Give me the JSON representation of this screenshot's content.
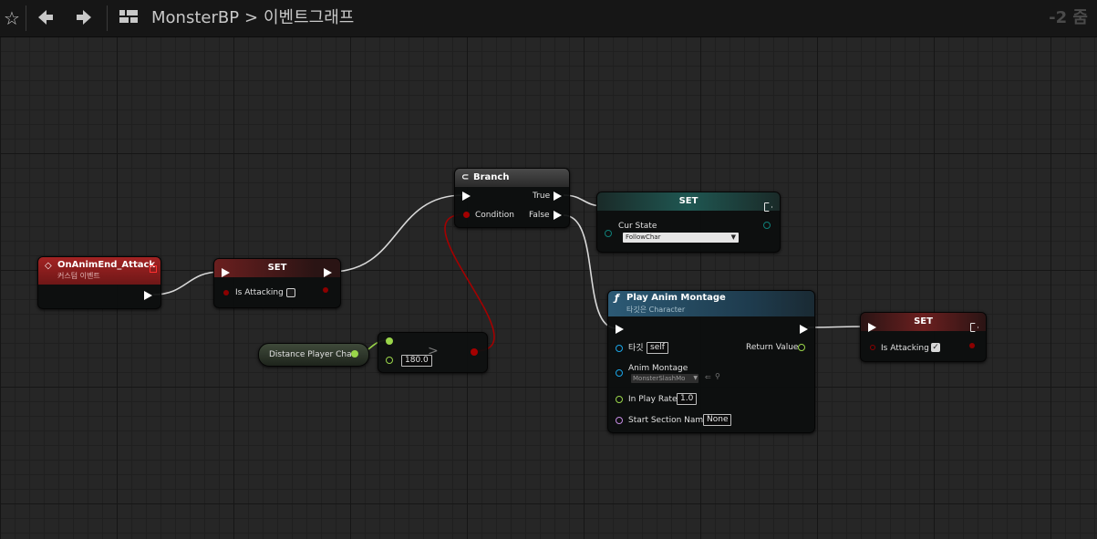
{
  "toolbar": {
    "star_icon": "☆",
    "back_icon": "🡄",
    "forward_icon": "🡆",
    "breadcrumb_root": "MonsterBP",
    "breadcrumb_sep": ">",
    "breadcrumb_current": "이벤트그래프",
    "zoom_label": "-2 줌"
  },
  "nodes": {
    "event": {
      "title": "OnAnimEnd_Attack",
      "subtitle": "커스텀 이벤트"
    },
    "set1": {
      "title": "SET",
      "pin": "Is Attacking"
    },
    "branch": {
      "title": "Branch",
      "true_label": "True",
      "false_label": "False",
      "condition_label": "Condition"
    },
    "set_state": {
      "title": "SET",
      "pin": "Cur State",
      "value": "FollowChar"
    },
    "distance": {
      "label": "Distance Player Char"
    },
    "compare": {
      "value": "180.0",
      "operator": ">"
    },
    "montage": {
      "title": "Play Anim Montage",
      "subtitle": "타깃은 Character",
      "target_label": "타깃",
      "target_value": "self",
      "return_label": "Return Value",
      "montage_label": "Anim Montage",
      "montage_value": "MonsterSlashMo",
      "rate_label": "In Play Rate",
      "rate_value": "1.0",
      "section_label": "Start Section Name",
      "section_value": "None"
    },
    "set2": {
      "title": "SET",
      "pin": "Is Attacking",
      "checked": "✓"
    }
  },
  "colors": {
    "event_header": "#8a1c1c",
    "set_header": "#5a1d1d",
    "branch_header": "#3d3d3d",
    "set_state_header": "#1d4a46",
    "montage_header": "#2a5068",
    "bool_pin": "#8c0000",
    "float_pin": "#9ad64a",
    "enum_pin": "#0f5f5a",
    "object_pin": "#1aa6e8",
    "name_pin": "#c58be3"
  }
}
